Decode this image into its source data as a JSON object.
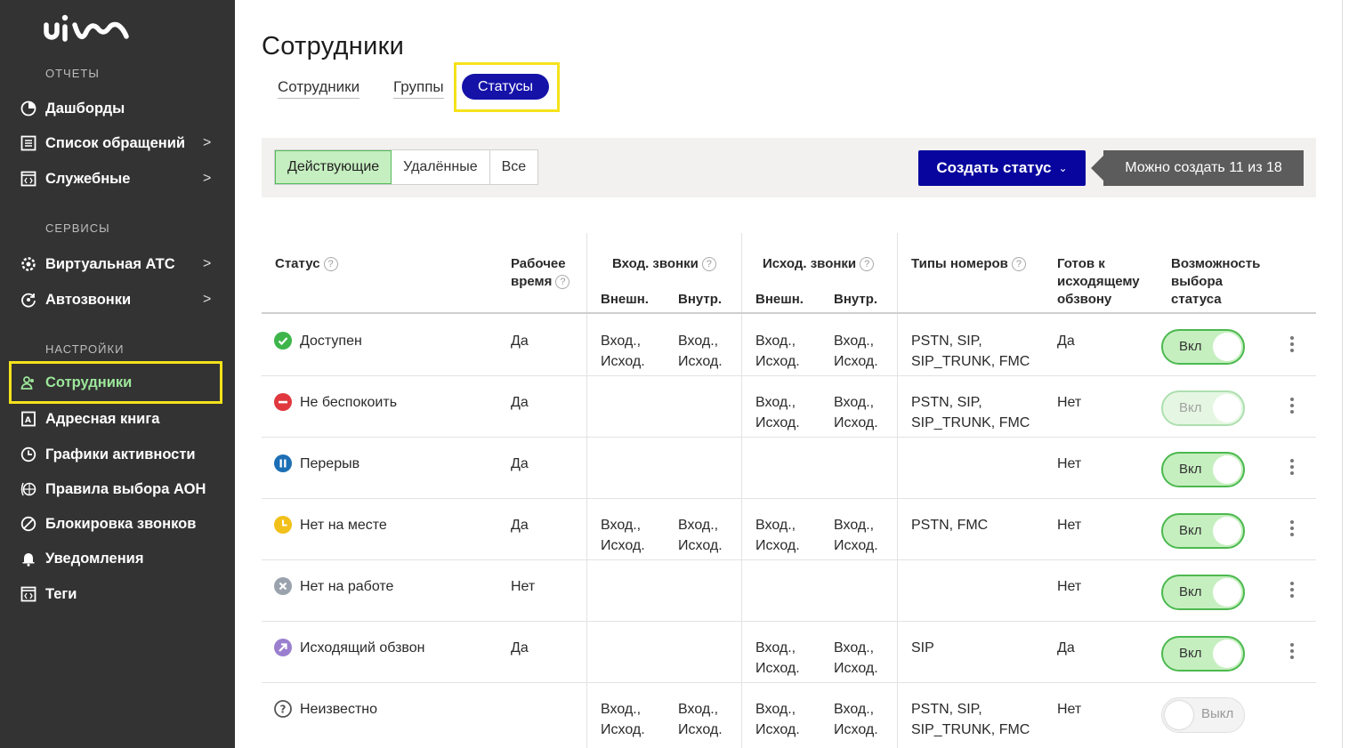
{
  "sidebar": {
    "logo": "uiս",
    "sections": [
      {
        "title": "ОТЧЕТЫ"
      },
      {
        "title": "СЕРВИСЫ"
      },
      {
        "title": "НАСТРОЙКИ"
      }
    ],
    "items": [
      {
        "label": "Дашборды",
        "icon": "pie-chart-icon",
        "chevron": ""
      },
      {
        "label": "Список обращений",
        "icon": "list-icon",
        "chevron": ">"
      },
      {
        "label": "Служебные",
        "icon": "code-window-icon",
        "chevron": ">"
      },
      {
        "label": "Виртуальная АТС",
        "icon": "gear-icon",
        "chevron": ">"
      },
      {
        "label": "Автозвонки",
        "icon": "refresh-phone-icon",
        "chevron": ">"
      },
      {
        "label": "Сотрудники",
        "icon": "users-icon",
        "chevron": ""
      },
      {
        "label": "Адресная книга",
        "icon": "address-book-icon",
        "chevron": ""
      },
      {
        "label": "Графики активности",
        "icon": "clock-icon",
        "chevron": ""
      },
      {
        "label": "Правила выбора АОН",
        "icon": "globe-icon",
        "chevron": ""
      },
      {
        "label": "Блокировка звонков",
        "icon": "block-icon",
        "chevron": ""
      },
      {
        "label": "Уведомления",
        "icon": "bell-icon",
        "chevron": ""
      },
      {
        "label": "Теги",
        "icon": "tag-window-icon",
        "chevron": ""
      }
    ]
  },
  "page": {
    "title": "Сотрудники",
    "tabs": [
      "Сотрудники",
      "Группы",
      "Статусы"
    ]
  },
  "toolbar": {
    "filters": [
      "Действующие",
      "Удалённые",
      "Все"
    ],
    "create_label": "Создать статус",
    "hint": "Можно создать 11 из 18"
  },
  "table": {
    "headers": {
      "status": "Статус",
      "work_time_1": "Рабочее",
      "work_time_2": "время",
      "in_calls": "Вход. звонки",
      "out_calls": "Исход. звонки",
      "ext": "Внешн.",
      "int": "Внутр.",
      "num_types": "Типы номеров",
      "ready_1": "Готов к",
      "ready_2": "исходящему",
      "ready_3": "обзвону",
      "select_1": "Возможность",
      "select_2": "выбора",
      "select_3": "статуса"
    },
    "rows": [
      {
        "name": "Доступен",
        "icon": "check-circle-icon",
        "color": "#3db54a",
        "work": "Да",
        "in_ext": [
          "Вход.,",
          "Исход."
        ],
        "in_int": [
          "Вход.,",
          "Исход."
        ],
        "out_ext": [
          "Вход.,",
          "Исход."
        ],
        "out_int": [
          "Вход.,",
          "Исход."
        ],
        "types": [
          "PSTN, SIP,",
          "SIP_TRUNK, FMC"
        ],
        "ready": "Да",
        "toggle": "Вкл",
        "state": "on"
      },
      {
        "name": "Не беспокоить",
        "icon": "minus-circle-icon",
        "color": "#e0383e",
        "work": "Да",
        "in_ext": [
          "",
          ""
        ],
        "in_int": [
          "",
          ""
        ],
        "out_ext": [
          "Вход.,",
          "Исход."
        ],
        "out_int": [
          "Вход.,",
          "Исход."
        ],
        "types": [
          "PSTN, SIP,",
          "SIP_TRUNK, FMC"
        ],
        "ready": "Нет",
        "toggle": "Вкл",
        "state": "dim"
      },
      {
        "name": "Перерыв",
        "icon": "pause-circle-icon",
        "color": "#1c6fb5",
        "work": "Да",
        "in_ext": [
          "",
          ""
        ],
        "in_int": [
          "",
          ""
        ],
        "out_ext": [
          "",
          ""
        ],
        "out_int": [
          "",
          ""
        ],
        "types": [
          "",
          ""
        ],
        "ready": "Нет",
        "toggle": "Вкл",
        "state": "on"
      },
      {
        "name": "Нет на месте",
        "icon": "clock-circle-icon",
        "color": "#f2c01a",
        "work": "Да",
        "in_ext": [
          "Вход.,",
          "Исход."
        ],
        "in_int": [
          "Вход.,",
          "Исход."
        ],
        "out_ext": [
          "Вход.,",
          "Исход."
        ],
        "out_int": [
          "Вход.,",
          "Исход."
        ],
        "types": [
          "PSTN, FMC",
          ""
        ],
        "ready": "Нет",
        "toggle": "Вкл",
        "state": "on"
      },
      {
        "name": "Нет на работе",
        "icon": "x-circle-icon",
        "color": "#9aa3ad",
        "work": "Нет",
        "in_ext": [
          "",
          ""
        ],
        "in_int": [
          "",
          ""
        ],
        "out_ext": [
          "",
          ""
        ],
        "out_int": [
          "",
          ""
        ],
        "types": [
          "",
          ""
        ],
        "ready": "Нет",
        "toggle": "Вкл",
        "state": "on"
      },
      {
        "name": "Исходящий обзвон",
        "icon": "arrow-circle-icon",
        "color": "#9b7fcf",
        "work": "Да",
        "in_ext": [
          "",
          ""
        ],
        "in_int": [
          "",
          ""
        ],
        "out_ext": [
          "Вход.,",
          "Исход."
        ],
        "out_int": [
          "Вход.,",
          "Исход."
        ],
        "types": [
          "SIP",
          ""
        ],
        "ready": "Да",
        "toggle": "Вкл",
        "state": "on"
      },
      {
        "name": "Неизвестно",
        "icon": "question-circle-icon",
        "color": "#555555",
        "work": "",
        "in_ext": [
          "Вход.,",
          "Исход."
        ],
        "in_int": [
          "Вход.,",
          "Исход."
        ],
        "out_ext": [
          "Вход.,",
          "Исход."
        ],
        "out_int": [
          "Вход.,",
          "Исход."
        ],
        "types": [
          "PSTN, SIP,",
          "SIP_TRUNK, FMC"
        ],
        "ready": "Нет",
        "toggle": "Выкл",
        "state": "off"
      }
    ]
  }
}
